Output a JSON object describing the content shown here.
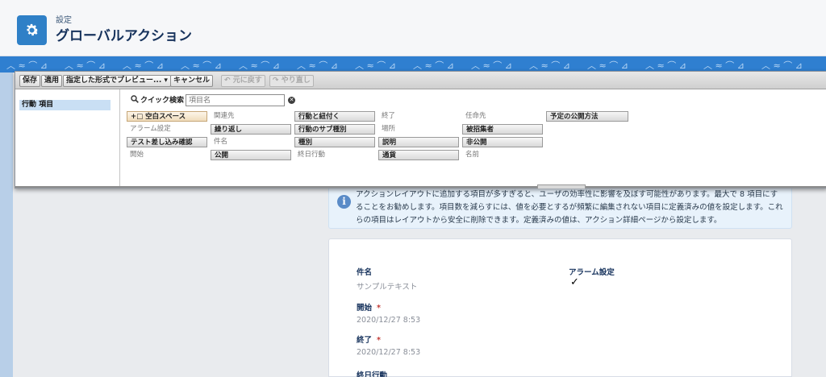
{
  "header": {
    "breadcrumb": "設定",
    "title": "グローバルアクション",
    "icon": "gear-icon"
  },
  "toolbar": {
    "save": "保存",
    "apply": "適用",
    "preview": "指定した形式でプレビュー... ▾",
    "cancel": "キャンセル",
    "undo": "元に戻す",
    "redo": "やり直し"
  },
  "sidebar": {
    "items": [
      {
        "label": "行動 項目"
      }
    ]
  },
  "quick_search": {
    "label": "クイック検索",
    "placeholder": "項目名",
    "clear": "✕"
  },
  "fields": {
    "rows": [
      [
        "+□ 空白スペース",
        "関連先",
        "行動と紐付く",
        "終了",
        "任命先",
        "予定の公開方法"
      ],
      [
        "アラーム設定",
        "繰り返し",
        "行動のサブ種別",
        "場所",
        "被招集者"
      ],
      [
        "テスト差し込み確認",
        "件名",
        "種別",
        "説明",
        "非公開"
      ],
      [
        "開始",
        "公開",
        "終日行動",
        "通貨",
        "名前"
      ]
    ]
  },
  "info": {
    "text_line1": "アクションレイアウトに追加する項目が多すぎると、ユーザの効率性に影響を及ぼす可能性があります。最大で 8 項目にす",
    "text_line2": "ることをお勧めします。項目数を減らすには、値を必要とするが頻繁に編集されない項目に定義済みの値を設定します。これ",
    "text_line3": "らの項目はレイアウトから安全に削除できます。定義済みの値は、アクション詳細ページから設定します。"
  },
  "layout": {
    "subject_label": "件名",
    "subject_value": "サンプルテキスト",
    "alarm_label": "アラーム設定",
    "alarm_checked": "✓",
    "start_label": "開始",
    "start_value": "2020/12/27 8:53",
    "end_label": "終了",
    "end_value": "2020/12/27 8:53",
    "allday_label": "終日行動",
    "required_mark": "*"
  }
}
